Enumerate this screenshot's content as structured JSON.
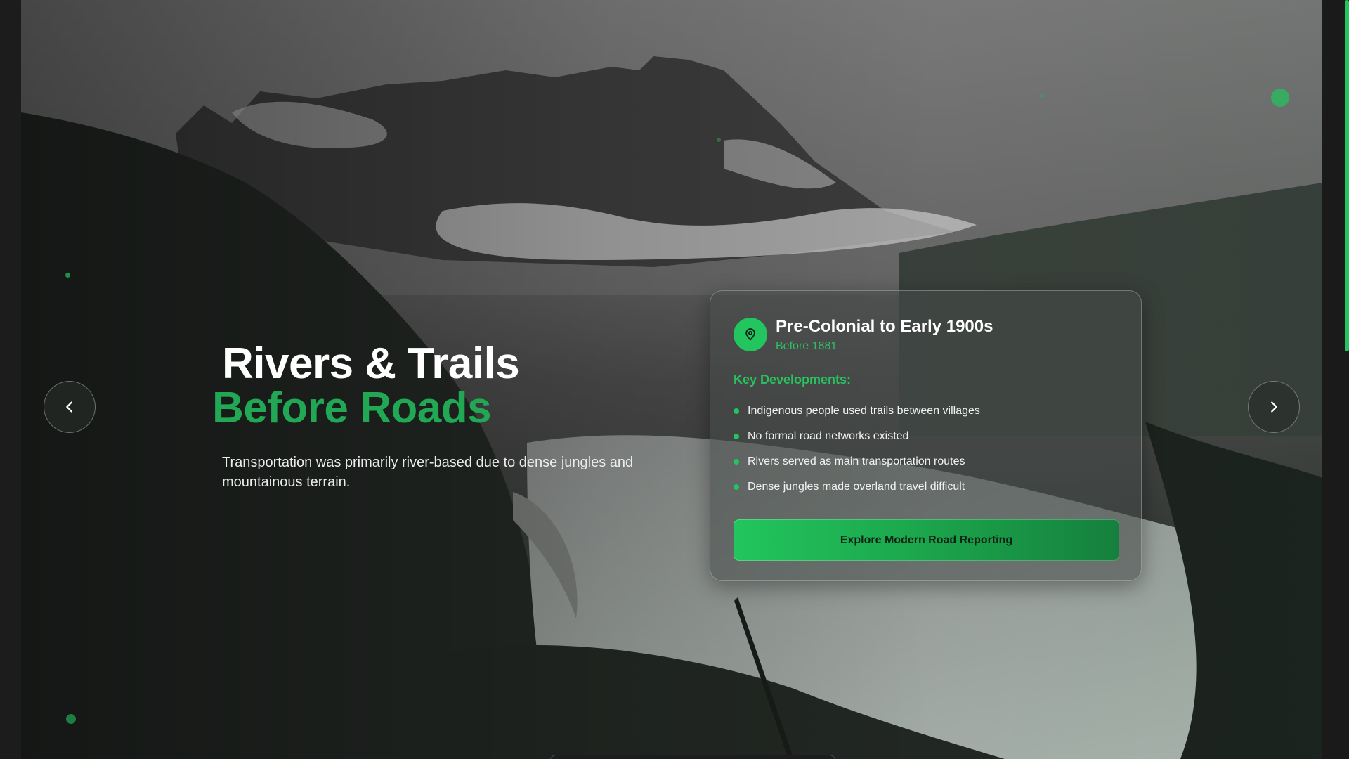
{
  "theme": {
    "accent": "#22c55e",
    "accent_dark": "#15803d",
    "heading_accent": "#22a855"
  },
  "hero": {
    "title_line1": "Rivers & Trails",
    "title_line2": "Before Roads",
    "description": "Transportation was primarily river-based due to dense jungles and mountainous terrain."
  },
  "nav": {
    "prev_icon": "chevron-left-icon",
    "next_icon": "chevron-right-icon"
  },
  "card": {
    "icon": "map-pin-icon",
    "title": "Pre-Colonial to Early 1900s",
    "period": "Before 1881",
    "section_label": "Key Developments:",
    "developments": [
      "Indigenous people used trails between villages",
      "No formal road networks existed",
      "Rivers served as main transportation routes",
      "Dense jungles made overland travel difficult"
    ],
    "cta_label": "Explore Modern Road Reporting"
  }
}
